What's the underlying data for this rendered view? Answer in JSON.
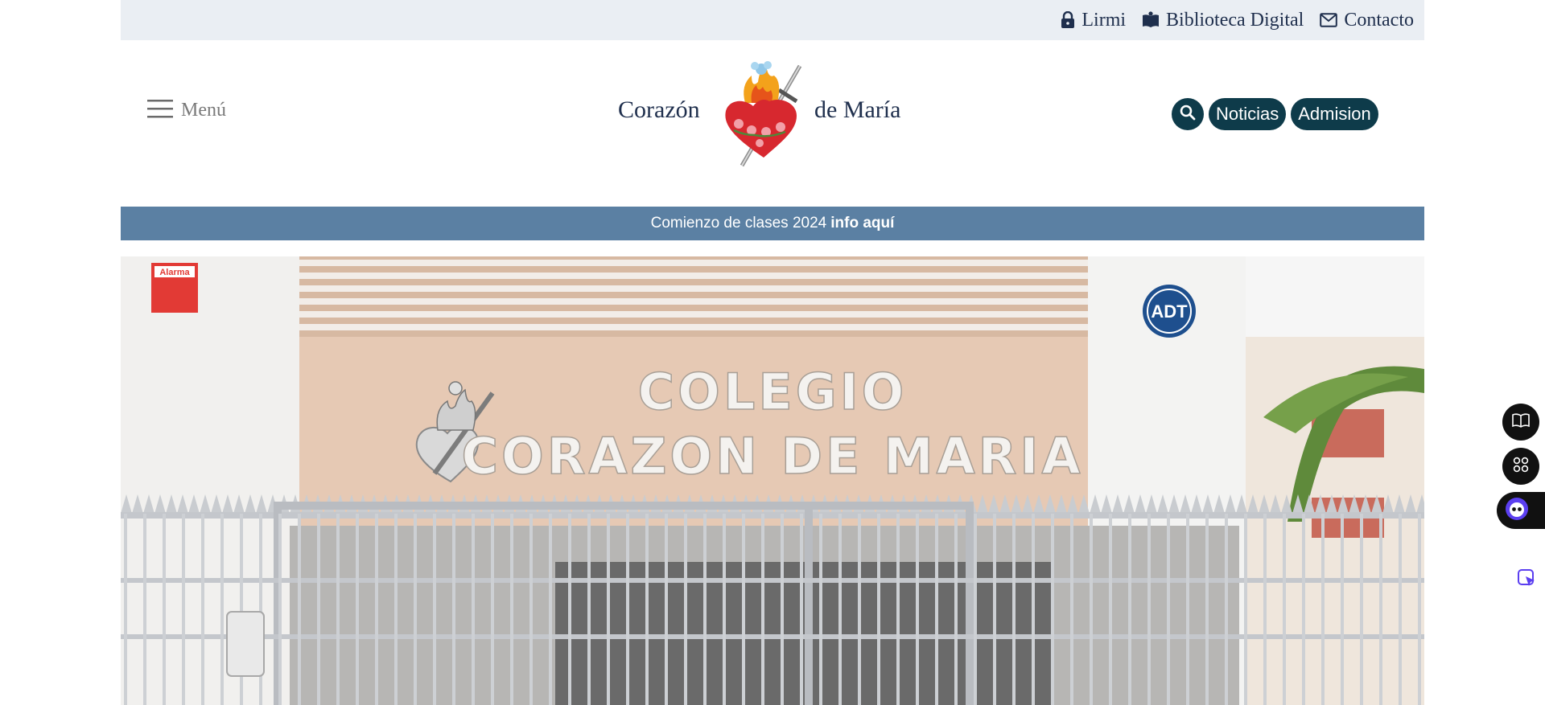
{
  "topbar": {
    "links": [
      {
        "label": "Lirmi",
        "icon": "lock-icon"
      },
      {
        "label": "Biblioteca Digital",
        "icon": "book-icon"
      },
      {
        "label": "Contacto",
        "icon": "mail-icon"
      }
    ]
  },
  "header": {
    "menu_label": "Menú",
    "brand_left": "Corazón",
    "brand_right": "de María",
    "actions": {
      "search_icon": "search-icon",
      "news_label": "Noticias",
      "admission_label": "Admision"
    }
  },
  "announcement": {
    "text": "Comienzo de clases 2024",
    "link_label": "info aquí"
  },
  "hero": {
    "sign_line1": "COLEGIO",
    "sign_line2": "CORAZON DE MARIA",
    "alarm_label": "Alarma",
    "adt_label": "ADT"
  },
  "floating": {
    "icons": [
      "open-book-icon",
      "apps-grid-icon",
      "chat-bot-icon",
      "cursor-pointer-icon"
    ]
  },
  "colors": {
    "topbar_bg": "#eaeef3",
    "navy_text": "#1f2f4d",
    "button_teal": "#0e3b4a",
    "announce_bg": "#5b80a3"
  }
}
